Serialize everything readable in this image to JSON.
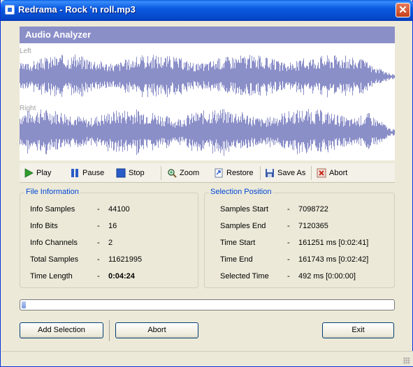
{
  "window": {
    "title": "Redrama - Rock 'n roll.mp3",
    "close_glyph": "✕"
  },
  "analyzer": {
    "header": "Audio Analyzer",
    "left_label": "Left",
    "right_label": "Right",
    "wave_color": "#8b8fc8"
  },
  "toolbar": [
    {
      "label": "Play",
      "icon": "play-icon"
    },
    {
      "label": "Pause",
      "icon": "pause-icon"
    },
    {
      "label": "Stop",
      "icon": "stop-icon"
    },
    {
      "label": "Zoom",
      "icon": "zoom-icon"
    },
    {
      "label": "Restore",
      "icon": "restore-icon"
    },
    {
      "label": "Save As",
      "icon": "save-icon"
    },
    {
      "label": "Abort",
      "icon": "abort-icon"
    }
  ],
  "file_info": {
    "title": "File Information",
    "rows": [
      {
        "label": "Info Samples",
        "sep": "-",
        "value": "44100"
      },
      {
        "label": "Info Bits",
        "sep": "-",
        "value": "16"
      },
      {
        "label": "Info Channels",
        "sep": "-",
        "value": "2"
      },
      {
        "label": "Total Samples",
        "sep": "-",
        "value": "11621995"
      },
      {
        "label": "Time Length",
        "sep": "-",
        "value": "0:04:24"
      }
    ]
  },
  "selection": {
    "title": "Selection Position",
    "rows": [
      {
        "label": "Samples Start",
        "sep": "-",
        "value": "7098722"
      },
      {
        "label": "Samples End",
        "sep": "-",
        "value": "7120365"
      },
      {
        "label": "Time Start",
        "sep": "-",
        "value": "161251 ms [0:02:41]"
      },
      {
        "label": "Time End",
        "sep": "-",
        "value": "161743 ms [0:02:42]"
      },
      {
        "label": "Selected Time",
        "sep": "-",
        "value": "492 ms [0:00:00]"
      }
    ]
  },
  "progress": {
    "fraction": 0.012
  },
  "buttons": {
    "add_selection": "Add Selection",
    "abort": "Abort",
    "exit": "Exit"
  }
}
